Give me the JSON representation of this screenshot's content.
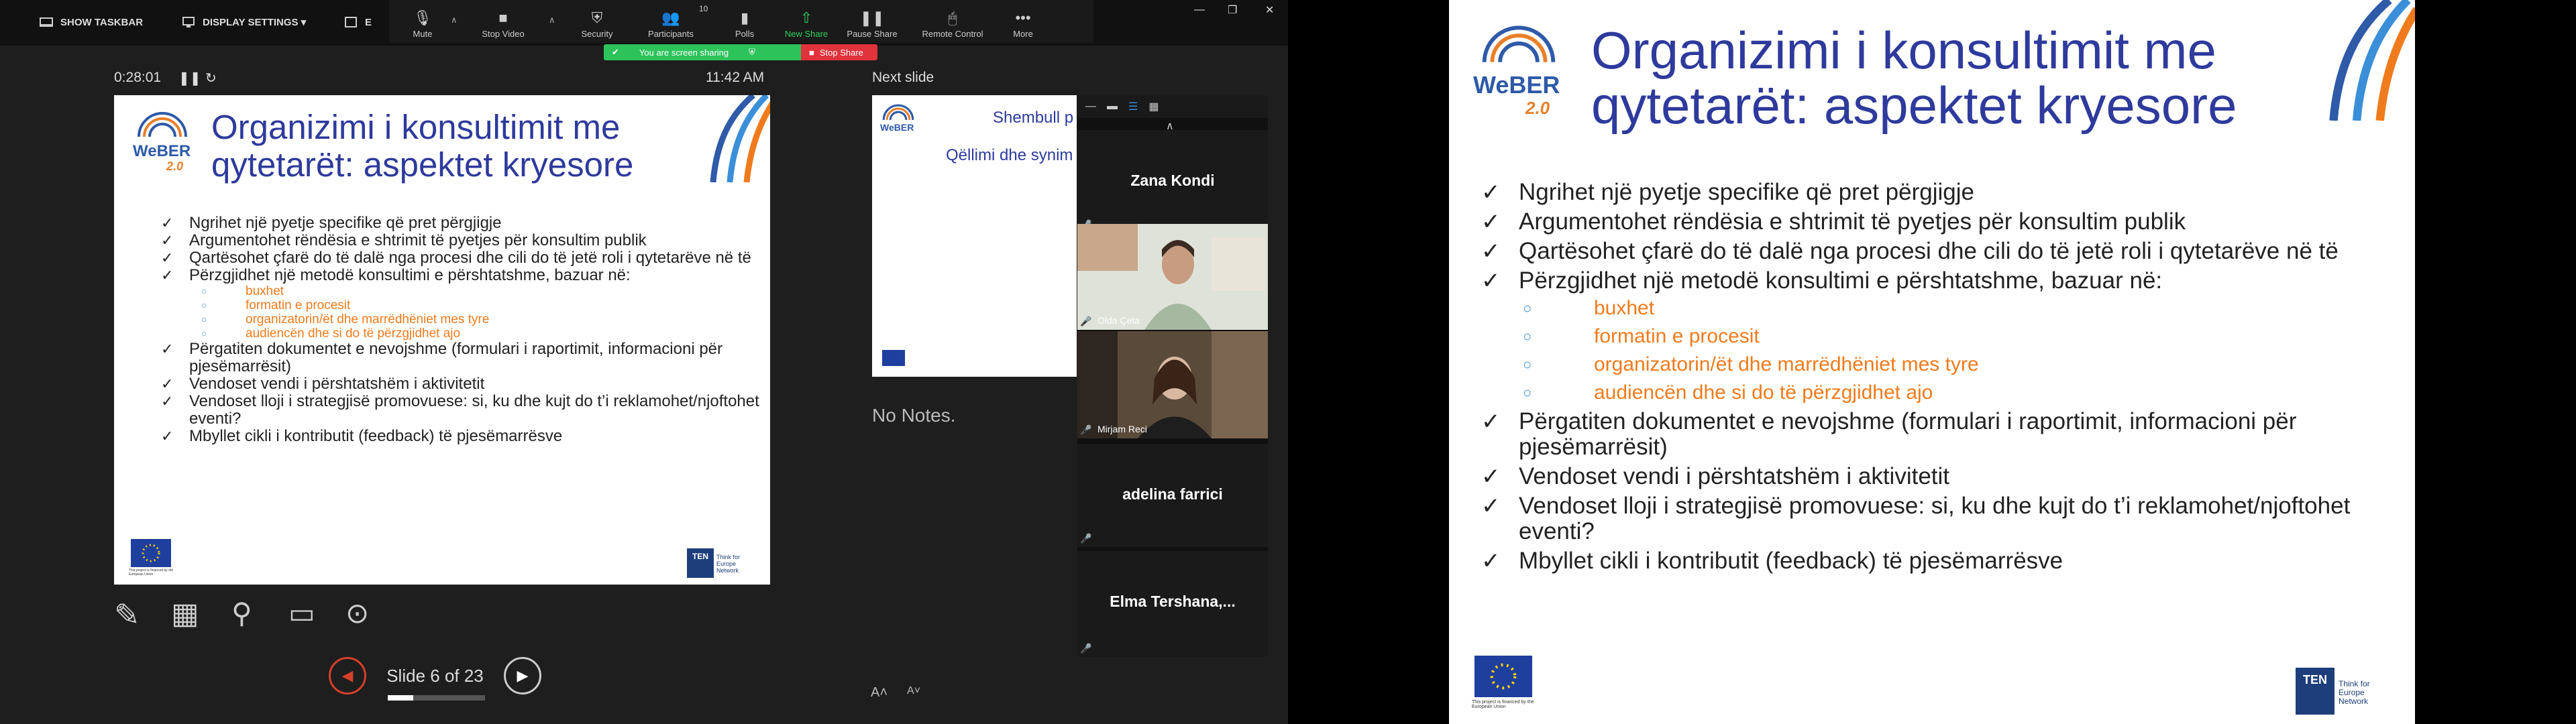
{
  "presenter_bar": {
    "show_taskbar": "SHOW TASKBAR",
    "display_settings": "DISPLAY SETTINGS ▾",
    "end_label": "E"
  },
  "zoom_toolbar": {
    "mute": "Mute",
    "stop_video": "Stop Video",
    "security": "Security",
    "participants": "Participants",
    "participants_count": "10",
    "polls": "Polls",
    "new_share": "New Share",
    "pause_share": "Pause Share",
    "remote_control": "Remote Control",
    "more": "More",
    "screen_sharing": "You are screen sharing",
    "stop_share": "Stop Share"
  },
  "presenter": {
    "timer": "0:28:01",
    "clock": "11:42 AM",
    "next_slide_label": "Next slide",
    "notes": "No Notes.",
    "slide_counter": "Slide 6 of 23",
    "slide_progress": 0.26
  },
  "slide": {
    "title_line1": "Organizimi i konsultimit me",
    "title_line2": "qytetarët: aspektet kryesore",
    "bullets": [
      "Ngrihet një pyetje specifike që pret përgjigje",
      "Argumentohet rëndësia e shtrimit të pyetjes për konsultim publik",
      "Qartësohet çfarë do të dalë nga procesi dhe cili do të jetë roli i qytetarëve në të",
      "Përzgjidhet një metodë konsultimi e përshtatshme, bazuar në:"
    ],
    "sub_bullets": [
      "buxhet",
      "formatin e procesit",
      "organizatorin/ët dhe marrëdhëniet mes tyre",
      "audiencën dhe si do të përzgjidhet ajo"
    ],
    "bullets2": [
      "Përgatiten dokumentet e nevojshme (formulari i raportimit, informacioni për pjesëmarrësit)",
      "Vendoset vendi i përshtatshëm i aktivitetit",
      "Vendoset lloji i strategjisë promovuese: si, ku dhe kujt do t’i reklamohet/njoftohet eventi?",
      "Mbyllet cikli i kontributit (feedback) të pjesëmarrësve"
    ],
    "logo_weber": "WeBER",
    "logo_version": "2.0",
    "ten_logo": "TEN",
    "ten_text": "Think for Europe Network",
    "eu_text": "This project is financed by the European Union"
  },
  "next_slide": {
    "title": "Shembull p",
    "subtitle": "Qëllimi dhe synim"
  },
  "participants": [
    {
      "name": "Zana Kondi",
      "video": false
    },
    {
      "name": "Olda Çeta",
      "video": true
    },
    {
      "name": "Mirjam Reci",
      "video": true
    },
    {
      "name": "adelina farrici",
      "video": false
    },
    {
      "name": "Elma  Tershana,...",
      "video": false
    }
  ],
  "colors": {
    "title_blue": "#2e3a9c",
    "orange": "#f07b1d",
    "share_green": "#2ec25b",
    "stop_red": "#e0333c"
  }
}
